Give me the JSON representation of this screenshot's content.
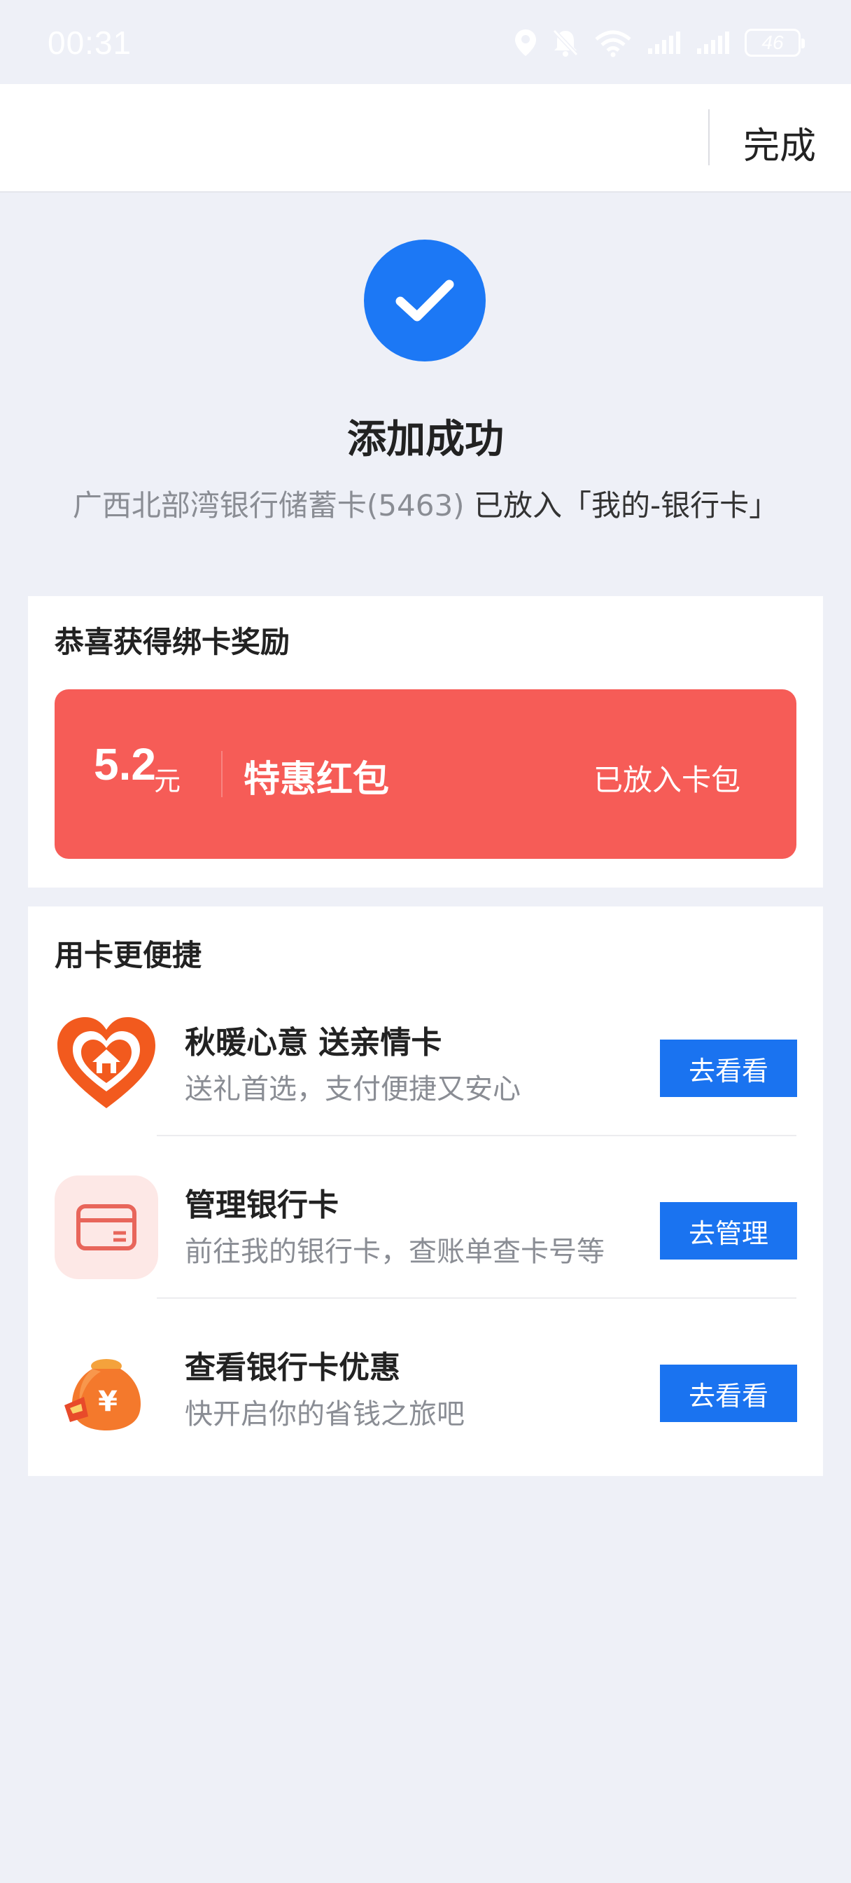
{
  "status_bar": {
    "time": "00:31",
    "battery": "46"
  },
  "nav": {
    "done_label": "完成"
  },
  "success": {
    "title": "添加成功",
    "card_name": "广西北部湾银行储蓄卡(5463)",
    "placed_text": "已放入「我的-银行卡」",
    "accent_color": "#1c78f5"
  },
  "reward": {
    "title": "恭喜获得绑卡奖励",
    "amount": "5.2",
    "unit": "元",
    "name": "特惠红包",
    "status": "已放入卡包",
    "color": "#f65c57"
  },
  "shortcuts": {
    "title": "用卡更便捷",
    "items": [
      {
        "icon": "heart-house-icon",
        "title": "秋暖心意 送亲情卡",
        "subtitle": "送礼首选，支付便捷又安心",
        "button": "去看看"
      },
      {
        "icon": "bank-card-icon",
        "title": "管理银行卡",
        "subtitle": "前往我的银行卡，查账单查卡号等",
        "button": "去管理"
      },
      {
        "icon": "money-bag-icon",
        "title": "查看银行卡优惠",
        "subtitle": "快开启你的省钱之旅吧",
        "button": "去看看"
      }
    ],
    "button_color": "#1a73f0"
  }
}
